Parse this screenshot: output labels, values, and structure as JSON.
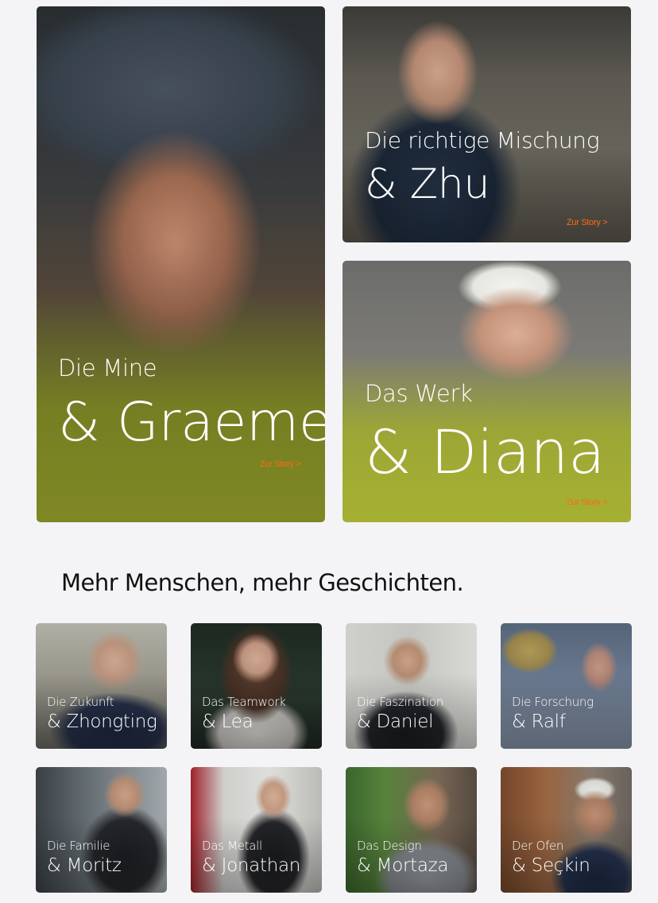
{
  "features": [
    {
      "id": "graeme",
      "kicker": "Die Mine",
      "name": "& Graeme",
      "more": "Zur Story >"
    },
    {
      "id": "zhu",
      "kicker": "Die richtige Mischung",
      "name": "& Zhu",
      "more": "Zur Story >"
    },
    {
      "id": "diana",
      "kicker": "Das Werk",
      "name": "& Diana",
      "more": "Zur Story >"
    }
  ],
  "section": {
    "title": "Mehr Menschen, mehr Geschichten."
  },
  "people": [
    {
      "kicker": "Die Zukunft",
      "name": "& Zhongting"
    },
    {
      "kicker": "Das Teamwork",
      "name": "& Lea"
    },
    {
      "kicker": "Die Faszination",
      "name": "& Daniel"
    },
    {
      "kicker": "Die Forschung",
      "name": "& Ralf"
    },
    {
      "kicker": "Die Familie",
      "name": "& Moritz"
    },
    {
      "kicker": "Das Metall",
      "name": "& Jonathan"
    },
    {
      "kicker": "Das Design",
      "name": "& Mortaza"
    },
    {
      "kicker": "Der Ofen",
      "name": "& Seçkin"
    }
  ],
  "colors": {
    "accent": "#ff6a13",
    "background": "#f4f4f7"
  }
}
